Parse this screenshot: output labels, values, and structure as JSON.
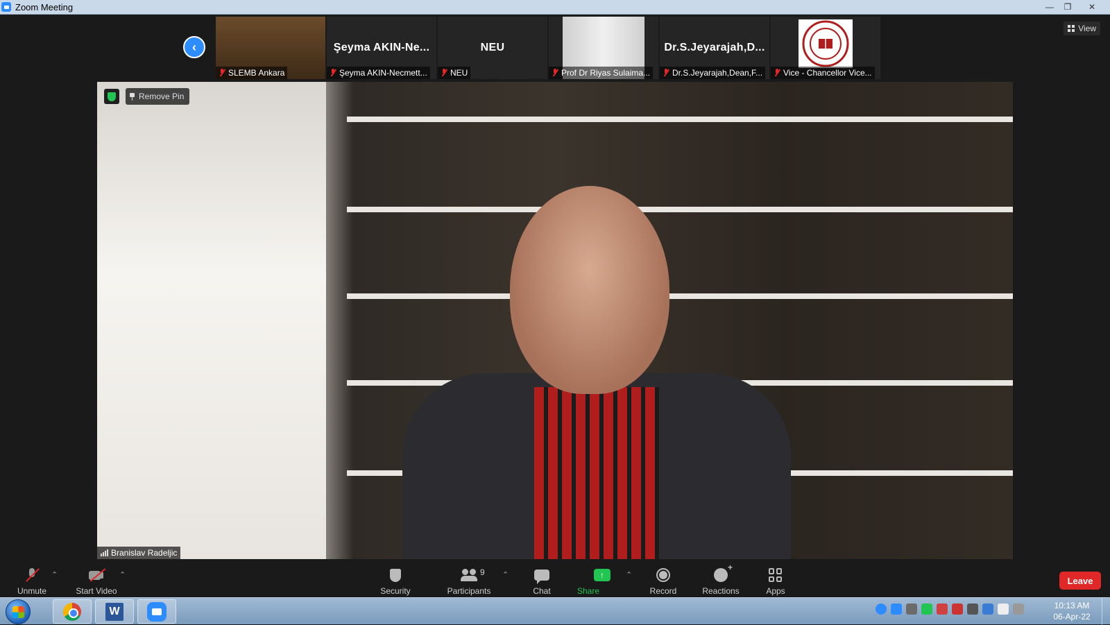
{
  "window": {
    "title": "Zoom Meeting",
    "minimize": "—",
    "restore": "❐",
    "close": "✕"
  },
  "view_button": {
    "label": "View"
  },
  "thumbnails": [
    {
      "display": "",
      "caption": "SLEMB Ankara"
    },
    {
      "display": "Şeyma  AKIN-Ne...",
      "caption": "Şeyma AKIN-Necmett..."
    },
    {
      "display": "NEU",
      "caption": "NEU"
    },
    {
      "display": "",
      "caption": "Prof Dr Riyas Sulaima..."
    },
    {
      "display": "Dr.S.Jeyarajah,D...",
      "caption": "Dr.S.Jeyarajah,Dean,F..."
    },
    {
      "display": "",
      "caption": "Vice - Chancellor Vice..."
    }
  ],
  "main_video": {
    "remove_pin": "Remove Pin",
    "speaker_name": "Branislav Radeljic"
  },
  "toolbar": {
    "unmute": "Unmute",
    "start_video": "Start Video",
    "security": "Security",
    "participants": "Participants",
    "participants_count": "9",
    "chat": "Chat",
    "share_screen": "Share Screen",
    "record": "Record",
    "reactions": "Reactions",
    "apps": "Apps",
    "leave": "Leave"
  },
  "taskbar": {
    "time": "10:13 AM",
    "date": "06-Apr-22",
    "word_letter": "W"
  },
  "colors": {
    "accent": "#2d8cff",
    "leave": "#e02828",
    "share": "#23c552"
  }
}
